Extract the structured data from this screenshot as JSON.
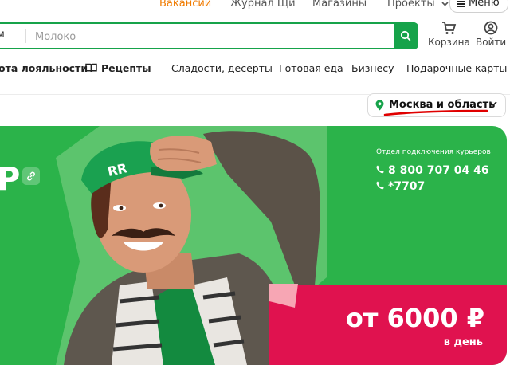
{
  "top_nav": {
    "vacancies": "Вакансии",
    "journal": "Журнал Щи",
    "stores": "Магазины",
    "projects": "Проекты",
    "menu": "Меню"
  },
  "search": {
    "category_fragment": "м",
    "placeholder": "Молоко"
  },
  "header_icons": {
    "cart": "Корзина",
    "login": "Войти"
  },
  "category_nav": [
    "ота лояльности",
    "Рецепты",
    "Сладости, десерты",
    "Готовая еда",
    "Бизнесу",
    "Подарочные карты"
  ],
  "region": {
    "label": "Москва и область"
  },
  "banner": {
    "currency_fragment": "Р",
    "courier_dept": "Отдел подключения курьеров",
    "phone_main": "8 800 707 04 46",
    "phone_short": "*7707",
    "offer_amount": "от 6000 ₽",
    "offer_period": "в день",
    "cap_text": "RR",
    "colors": {
      "banner_green": "#2bb34a",
      "light_green": "#5cc46d",
      "offer_pink": "#e0124f",
      "accent_orange": "#f07b00",
      "annotation_red": "#e00000"
    }
  }
}
